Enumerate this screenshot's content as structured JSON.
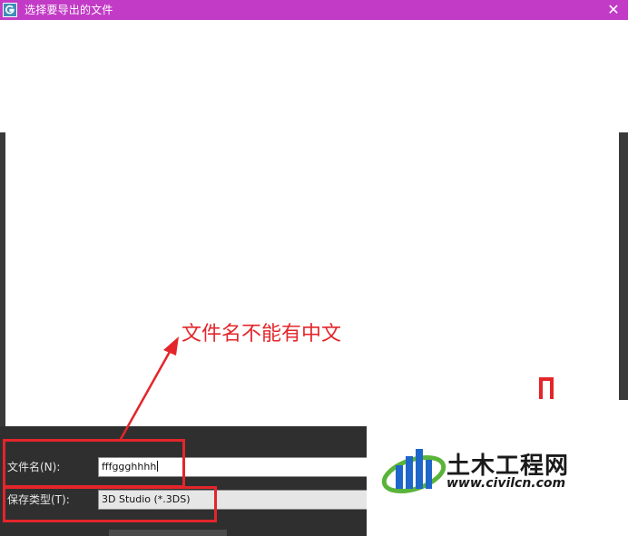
{
  "window": {
    "title": "选择要导出的文件",
    "close_glyph": "✕",
    "app_icon": "gmax-icon"
  },
  "form": {
    "filename_label": "文件名(N):",
    "filename_value": "fffggghhhh",
    "filetype_label": "保存类型(T):",
    "filetype_value": "3D Studio (*.3DS)"
  },
  "annotation": {
    "text": "文件名不能有中文",
    "color": "#e3262b"
  },
  "watermark": {
    "brand": "土木工程网",
    "url": "www.civilcn.com"
  },
  "colors": {
    "titlebar": "#c23bc6",
    "panel": "#2f2f2f",
    "accent_red": "#e3262b",
    "logo_blue": "#1e66c9",
    "logo_green": "#5ab43a"
  }
}
